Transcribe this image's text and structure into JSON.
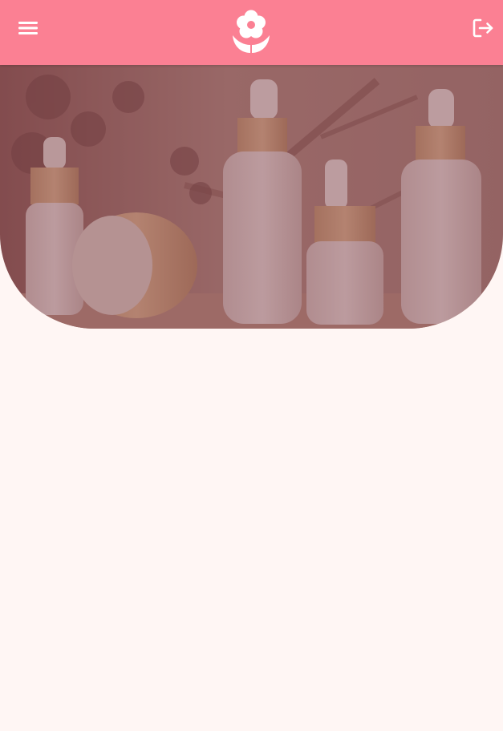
{
  "header": {
    "menu_icon": "hamburger-menu-icon",
    "logo_icon": "flower-hand-logo",
    "logout_icon": "logout-icon"
  },
  "hero": {
    "image": "skincare-bottles-photo"
  },
  "colors": {
    "header_bg": "#fb8093",
    "page_bg": "#fff6f4",
    "hero_overlay": "#7a3a45",
    "icon": "#ffffff"
  }
}
